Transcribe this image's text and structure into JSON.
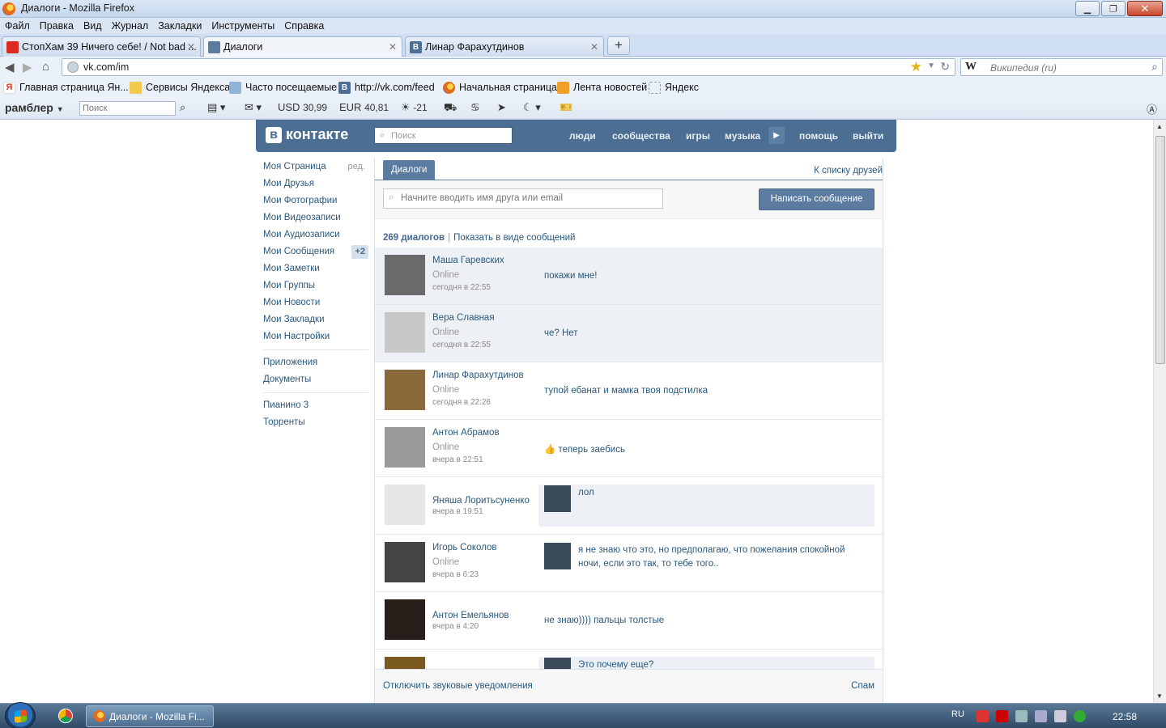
{
  "window": {
    "title": "Диалоги - Mozilla Firefox"
  },
  "menubar": [
    "Файл",
    "Правка",
    "Вид",
    "Журнал",
    "Закладки",
    "Инструменты",
    "Справка"
  ],
  "tabs": [
    {
      "label": "СтопХам 39 Ничего себе! / Not bad ...",
      "icon": "youtube-icon"
    },
    {
      "label": "Диалоги",
      "icon": "vk-dialog-icon"
    },
    {
      "label": "Линар Фарахутдинов",
      "icon": "vk-icon"
    }
  ],
  "navbar": {
    "url": "vk.com/im",
    "search_engine": "W",
    "search_placeholder": "Википедия (ru)"
  },
  "bookmarks": [
    "Главная страница Ян...",
    "Сервисы Яндекса",
    "Часто посещаемые",
    "http://vk.com/feed",
    "Начальная страница",
    "Лента новостей",
    "Яндекс"
  ],
  "rambler": {
    "logo": "рамблер",
    "search_placeholder": "Поиск",
    "usd_label": "USD",
    "usd_value": "30,99",
    "eur_label": "EUR",
    "eur_value": "40,81",
    "temperature": "-21"
  },
  "vk": {
    "logo": "контакте",
    "logo_letter": "в",
    "search_placeholder": "Поиск",
    "nav": [
      "люди",
      "сообщества",
      "игры",
      "музыка",
      "помощь",
      "выйти"
    ],
    "left_menu": {
      "edit_label": "ред.",
      "items": [
        "Моя Страница",
        "Мои Друзья",
        "Мои Фотографии",
        "Мои Видеозаписи",
        "Мои Аудиозаписи",
        "Мои Сообщения",
        "Мои Заметки",
        "Мои Группы",
        "Мои Новости",
        "Мои Закладки",
        "Мои Настройки"
      ],
      "messages_badge": "+2",
      "apps": [
        "Приложения",
        "Документы"
      ],
      "custom": [
        "Пианино 3",
        "Торренты"
      ]
    },
    "dialogs_tab": "Диалоги",
    "to_friends": "К списку друзей",
    "friend_search_placeholder": "Начните вводить имя друга или email",
    "write_button": "Написать сообщение",
    "summary": {
      "count": "269 диалогов",
      "show_as_messages": "Показать в виде сообщений"
    },
    "dialogs": [
      {
        "name": "Маша Гаревских",
        "status": "Online",
        "time": "сегодня в 22:55",
        "text": "покажи мне!",
        "unread": true,
        "avatar_color": "#6b6b6b"
      },
      {
        "name": "Вера Славная",
        "status": "Online",
        "time": "сегодня в 22:55",
        "text": "че? Нет",
        "unread": true,
        "avatar_color": "#c8c8c8"
      },
      {
        "name": "Линар Фарахутдинов",
        "status": "Online",
        "time": "сегодня в 22:26",
        "text": "тупой ебанат и мамка твоя подстилка",
        "unread": false,
        "avatar_color": "#8a6a3a"
      },
      {
        "name": "Антон Абрамов",
        "status": "Online",
        "time": "вчера в 22:51",
        "text": "теперь заебись",
        "unread": false,
        "avatar_color": "#9a9a9a"
      },
      {
        "name": "Яняша Лоритьсуненко",
        "status": "",
        "time": "вчера в 19:51",
        "text": "лол",
        "unread": false,
        "reply": true,
        "avatar_color": "#e6e6e6"
      },
      {
        "name": "Игорь Соколов",
        "status": "Online",
        "time": "вчера в 6:23",
        "text": "я не знаю что это, но предполагаю, что пожелания спокойной ночи, если это так, то тебе того..",
        "unread": false,
        "reply_plain": true,
        "avatar_color": "#444"
      },
      {
        "name": "Антон Емельянов",
        "status": "",
        "time": "вчера в 4:20",
        "text": "не знаю)))) пальцы толстые",
        "unread": false,
        "avatar_color": "#2a1e1a"
      },
      {
        "name": "",
        "status": "",
        "time": "",
        "text": "Это почему еще?",
        "unread": false,
        "reply": true,
        "avatar_color": "#7a5a20"
      }
    ],
    "footer": {
      "sound_off": "Отключить звуковые уведомления",
      "spam": "Спам"
    }
  },
  "taskbar": {
    "task_label": "Диалоги - Mozilla Fi...",
    "lang": "RU",
    "clock": "22:58"
  }
}
